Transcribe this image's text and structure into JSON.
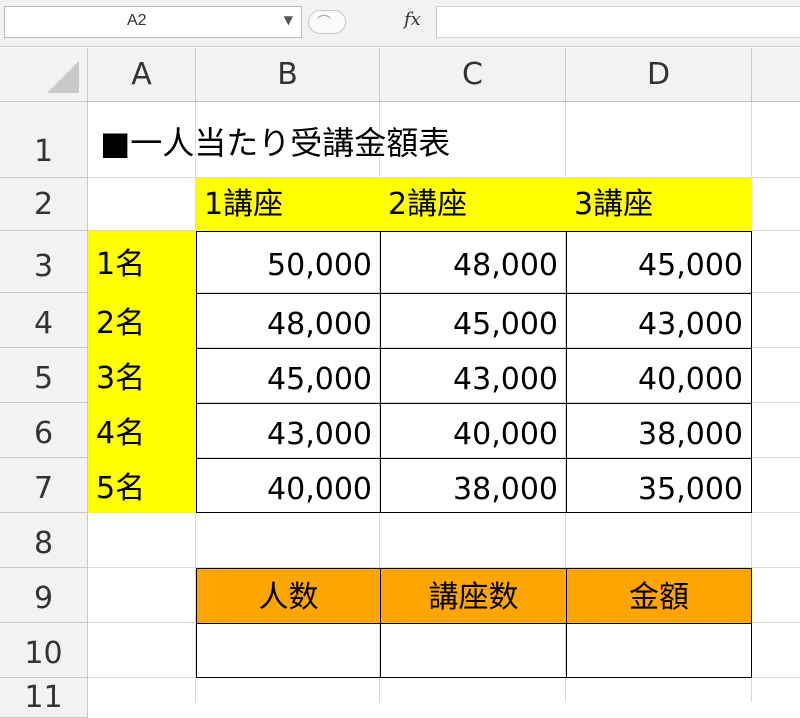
{
  "formula_bar": {
    "name_box": "A2",
    "fx_label": "fx",
    "formula": ""
  },
  "columns": [
    "A",
    "B",
    "C",
    "D"
  ],
  "rows": [
    "1",
    "2",
    "3",
    "4",
    "5",
    "6",
    "7",
    "8",
    "9",
    "10",
    "11"
  ],
  "sheet": {
    "title": "■一人当たり受講金額表",
    "course_headers": [
      "1講座",
      "2講座",
      "3講座"
    ],
    "table": [
      {
        "people": "1名",
        "values": [
          "50,000",
          "48,000",
          "45,000"
        ]
      },
      {
        "people": "2名",
        "values": [
          "48,000",
          "45,000",
          "43,000"
        ]
      },
      {
        "people": "3名",
        "values": [
          "45,000",
          "43,000",
          "40,000"
        ]
      },
      {
        "people": "4名",
        "values": [
          "43,000",
          "40,000",
          "38,000"
        ]
      },
      {
        "people": "5名",
        "values": [
          "40,000",
          "38,000",
          "35,000"
        ]
      }
    ],
    "input_headers": [
      "人数",
      "講座数",
      "金額"
    ],
    "input_values": [
      "",
      "",
      ""
    ]
  },
  "colors": {
    "header_yellow": "#ffff00",
    "input_orange": "#ffa500",
    "grid": "#dadada",
    "chrome": "#f2f2f2"
  }
}
